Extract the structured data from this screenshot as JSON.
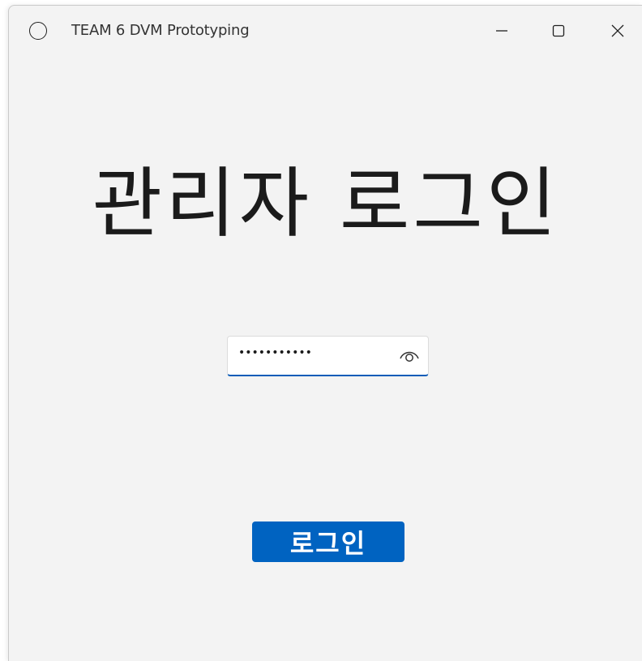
{
  "window": {
    "title": "TEAM 6 DVM Prototyping"
  },
  "main": {
    "heading": "관리자 로그인",
    "password": {
      "masked_value": "•••••••••••",
      "reveal_icon": "eye-icon"
    },
    "login_button_label": "로그인"
  },
  "colors": {
    "accent": "#0063c1",
    "background": "#f3f3f3"
  }
}
